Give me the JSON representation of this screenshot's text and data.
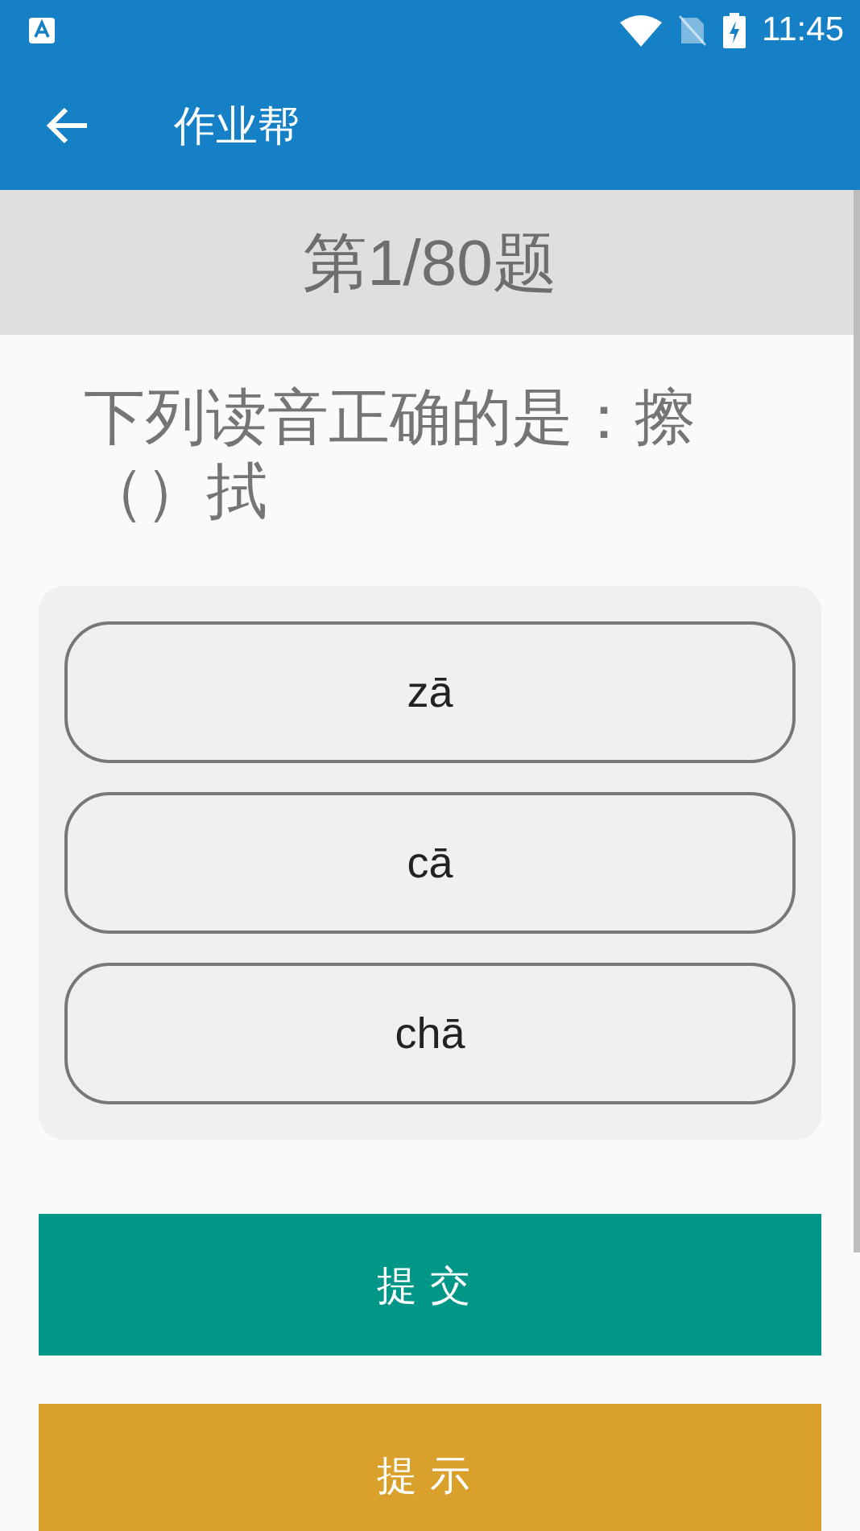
{
  "status_bar": {
    "time": "11:45"
  },
  "app_bar": {
    "title": "作业帮"
  },
  "progress": "第1/80题",
  "question": "下列读音正确的是：擦（）拭",
  "options": [
    {
      "label": "zā",
      "selected": false
    },
    {
      "label": "cā",
      "selected": false
    },
    {
      "label": "chā",
      "selected": false
    }
  ],
  "buttons": [
    {
      "label": "提交",
      "kind": "submit"
    },
    {
      "label": "提示",
      "kind": "hint"
    }
  ]
}
